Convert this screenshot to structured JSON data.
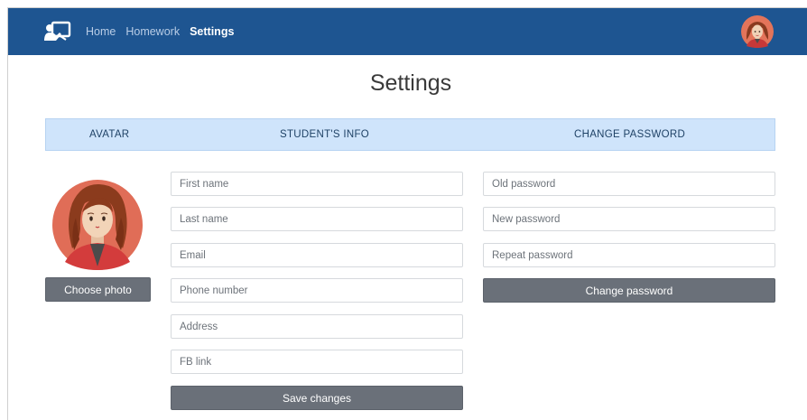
{
  "nav": {
    "links": [
      "Home",
      "Homework",
      "Settings"
    ],
    "active_index": 2,
    "logo_icon": "classroom-presentation-icon",
    "user_avatar_icon": "user-avatar-icon"
  },
  "page": {
    "title": "Settings"
  },
  "sections": {
    "avatar": "AVATAR",
    "student_info": "STUDENT'S INFO",
    "change_password": "CHANGE PASSWORD"
  },
  "avatar_panel": {
    "image": "female-avatar-illustration",
    "choose_photo_label": "Choose photo"
  },
  "student_info": {
    "fields": [
      {
        "placeholder": "First name",
        "value": ""
      },
      {
        "placeholder": "Last name",
        "value": ""
      },
      {
        "placeholder": "Email",
        "value": ""
      },
      {
        "placeholder": "Phone number",
        "value": ""
      },
      {
        "placeholder": "Address",
        "value": ""
      },
      {
        "placeholder": "FB link",
        "value": ""
      }
    ],
    "save_label": "Save changes"
  },
  "password": {
    "fields": [
      {
        "placeholder": "Old password",
        "value": ""
      },
      {
        "placeholder": "New password",
        "value": ""
      },
      {
        "placeholder": "Repeat password",
        "value": ""
      }
    ],
    "change_label": "Change password"
  },
  "colors": {
    "navbar": "#1e5591",
    "section_bar": "#cfe4fb",
    "button": "#6a7079"
  }
}
